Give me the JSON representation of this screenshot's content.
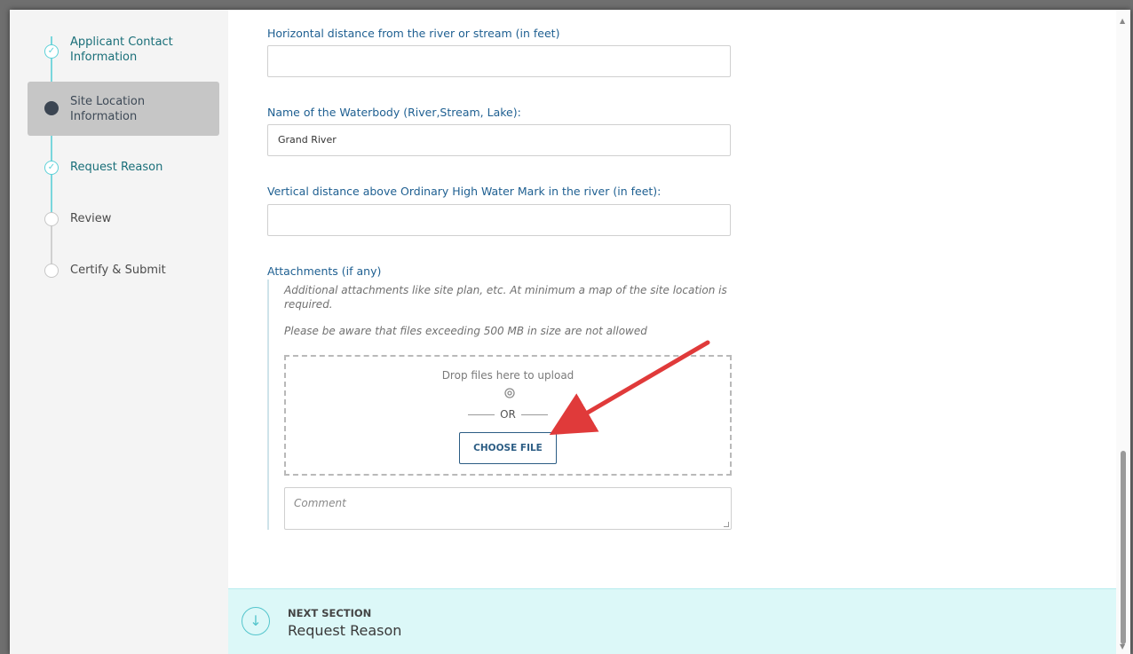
{
  "sidebar": {
    "steps": [
      {
        "label": "Applicant Contact Information",
        "status": "done"
      },
      {
        "label": "Site Location Information",
        "status": "current"
      },
      {
        "label": "Request Reason",
        "status": "done"
      },
      {
        "label": "Review",
        "status": "todo"
      },
      {
        "label": "Certify & Submit",
        "status": "todo"
      }
    ]
  },
  "form": {
    "horizontal_distance": {
      "label": "Horizontal distance from the river or stream (in feet)",
      "value": ""
    },
    "waterbody_name": {
      "label": "Name of the Waterbody (River,Stream, Lake):",
      "value": "Grand River"
    },
    "vertical_distance": {
      "label": "Vertical distance above Ordinary High Water Mark in the river (in feet):",
      "value": ""
    },
    "attachments": {
      "label": "Attachments (if any)",
      "hint1": "Additional attachments like site plan, etc. At minimum a map of the site location is required.",
      "hint2": "Please be aware that files exceeding 500 MB in size are not allowed",
      "drop_text": "Drop files here to upload",
      "or_text": "OR",
      "choose_button": "CHOOSE FILE",
      "comment_placeholder": "Comment"
    }
  },
  "next_section": {
    "kicker": "NEXT SECTION",
    "title": "Request Reason"
  },
  "icons": {
    "check": "check-icon",
    "paperclip": "paperclip-icon",
    "arrow_down": "arrow-down-icon"
  },
  "colors": {
    "accent_teal": "#5dd1d8",
    "label_blue": "#1e5f91",
    "next_bar_bg": "#dcf8f8",
    "annotation_red": "#e03a3a"
  }
}
